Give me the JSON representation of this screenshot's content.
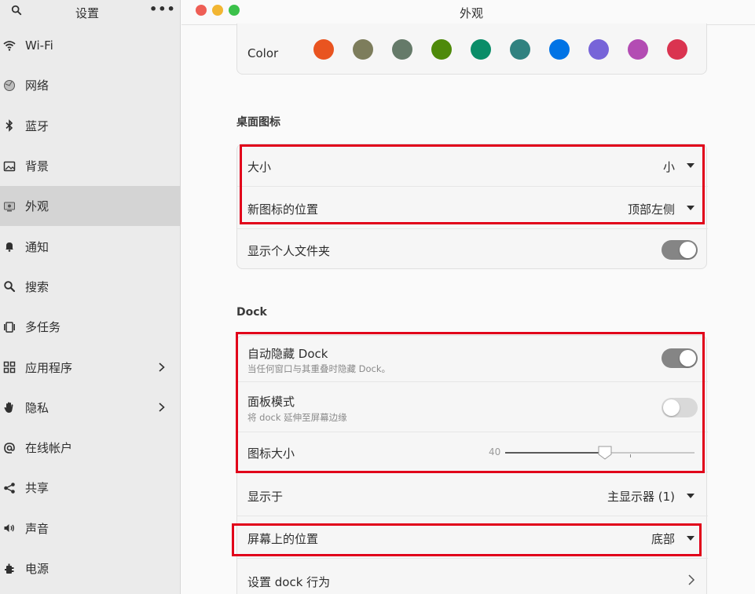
{
  "sidebar": {
    "title": "设置",
    "items": [
      {
        "label": "Wi-Fi",
        "icon": "wifi-icon"
      },
      {
        "label": "网络",
        "icon": "network-icon"
      },
      {
        "label": "蓝牙",
        "icon": "bluetooth-icon"
      },
      {
        "label": "背景",
        "icon": "background-icon"
      },
      {
        "label": "外观",
        "icon": "appearance-icon",
        "active": true
      },
      {
        "label": "通知",
        "icon": "bell-icon"
      },
      {
        "label": "搜索",
        "icon": "search-icon"
      },
      {
        "label": "多任务",
        "icon": "multitask-icon"
      },
      {
        "label": "应用程序",
        "icon": "apps-grid-icon",
        "chevron": true
      },
      {
        "label": "隐私",
        "icon": "hand-icon",
        "chevron": true
      },
      {
        "label": "在线帐户",
        "icon": "at-icon"
      },
      {
        "label": "共享",
        "icon": "share-icon"
      },
      {
        "label": "声音",
        "icon": "speaker-icon"
      },
      {
        "label": "电源",
        "icon": "power-icon"
      }
    ]
  },
  "window": {
    "title": "外观"
  },
  "color": {
    "label": "Color",
    "swatches": [
      "#e95420",
      "#7d7d5c",
      "#657a69",
      "#4e8a0a",
      "#0a8d68",
      "#308280",
      "#0073e5",
      "#7764d8",
      "#b34cb3",
      "#da3450"
    ]
  },
  "desktop_icons": {
    "title": "桌面图标",
    "size_label": "大小",
    "size_value": "小",
    "position_label": "新图标的位置",
    "position_value": "顶部左侧",
    "home_label": "显示个人文件夹",
    "home_on": true
  },
  "dock": {
    "title": "Dock",
    "autohide_label": "自动隐藏 Dock",
    "autohide_sub": "当任何窗口与其重叠时隐藏 Dock。",
    "autohide_on": true,
    "panel_label": "面板模式",
    "panel_sub": "将 dock 延伸至屏幕边缘",
    "panel_on": false,
    "iconsize_label": "图标大小",
    "iconsize_value": "40",
    "iconsize_fraction": 0.525,
    "show_on_label": "显示于",
    "show_on_value": "主显示器 (1)",
    "position_label": "屏幕上的位置",
    "position_value": "底部",
    "behavior_label": "设置 dock 行为"
  },
  "highlight_color": "#e1001a"
}
